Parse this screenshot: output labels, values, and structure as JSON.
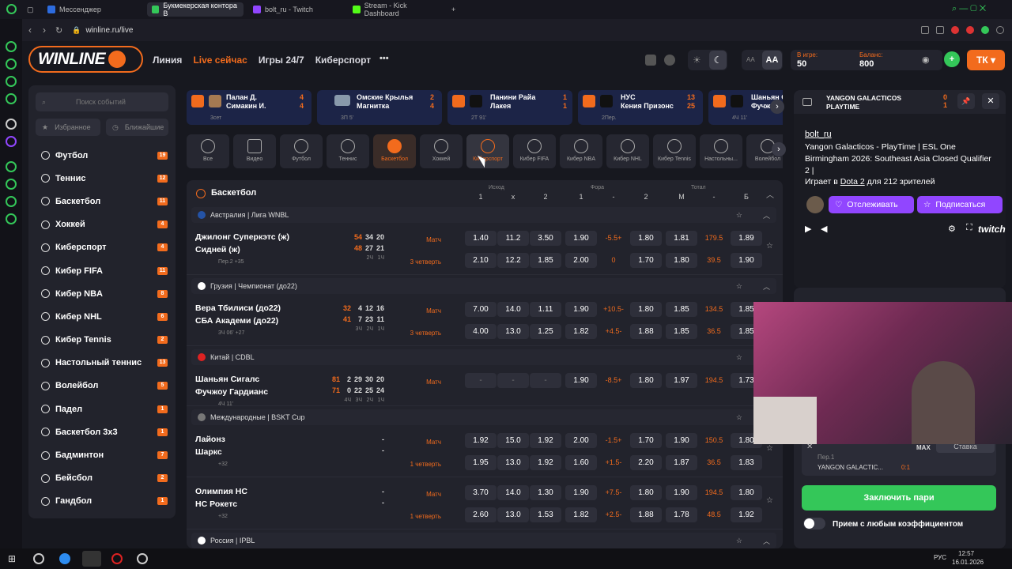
{
  "browser": {
    "tabs": [
      "Мессенджер",
      "Букмекерская контора В",
      "bolt_ru - Twitch",
      "Stream - Kick Dashboard"
    ],
    "url": "winline.ru/live",
    "taskbar_time": "12:57",
    "taskbar_date": "16.01.2026",
    "taskbar_lang": "РУС"
  },
  "header": {
    "logo": "WINLINE",
    "nav": [
      "Линия",
      "Live сейчас",
      "Игры 24/7",
      "Киберспорт"
    ],
    "more": "•••",
    "font_small": "AA",
    "font_large": "AA",
    "in_game_label": "В игре:",
    "in_game_value": "50",
    "balance_label": "Баланс:",
    "balance_value": "800",
    "user_initials": "ТК"
  },
  "sidebar": {
    "search_placeholder": "Поиск событий",
    "tab_fav": "Избранное",
    "tab_near": "Ближайшие",
    "items": [
      {
        "label": "Футбол",
        "count": "19"
      },
      {
        "label": "Теннис",
        "count": "12"
      },
      {
        "label": "Баскетбол",
        "count": "11"
      },
      {
        "label": "Хоккей",
        "count": "4"
      },
      {
        "label": "Киберспорт",
        "count": "4"
      },
      {
        "label": "Кибер FIFA",
        "count": "11"
      },
      {
        "label": "Кибер NBA",
        "count": "8"
      },
      {
        "label": "Кибер NHL",
        "count": "6"
      },
      {
        "label": "Кибер Tennis",
        "count": "2"
      },
      {
        "label": "Настольный теннис",
        "count": "13"
      },
      {
        "label": "Волейбол",
        "count": "5"
      },
      {
        "label": "Падел",
        "count": "1"
      },
      {
        "label": "Баскетбол 3х3",
        "count": "1"
      },
      {
        "label": "Бадминтон",
        "count": "7"
      },
      {
        "label": "Бейсбол",
        "count": "2"
      },
      {
        "label": "Гандбол",
        "count": "1"
      }
    ]
  },
  "live_cards": [
    {
      "t1": "Палан Д.",
      "t2": "Симакин И.",
      "s1": "4",
      "s2": "4",
      "info": "3сет"
    },
    {
      "t1": "Омские Крылья",
      "t2": "Магнитка",
      "s1": "2",
      "s2": "4",
      "info": "3П 5'"
    },
    {
      "t1": "Панини Райа",
      "t2": "Лакея",
      "s1": "1",
      "s2": "1",
      "info": "2Т 91'"
    },
    {
      "t1": "НУС",
      "t2": "Кения Призонс",
      "s1": "13",
      "s2": "25",
      "info": "2Пер."
    },
    {
      "t1": "Шаньян С",
      "t2": "Фучж",
      "s1": "",
      "s2": "",
      "info": "4Ч 11'"
    }
  ],
  "categories": [
    "Все",
    "Видео",
    "Футбол",
    "Теннис",
    "Баскетбол",
    "Хоккей",
    "Киберспорт",
    "Кибер FIFA",
    "Кибер NBA",
    "Кибер NHL",
    "Кибер Tennis",
    "Настольны...",
    "Волейбол"
  ],
  "table": {
    "sport": "Баскетбол",
    "col_groups": [
      "Исход",
      "Фора",
      "Тотал"
    ],
    "cols": [
      "1",
      "x",
      "2",
      "1",
      "-",
      "2",
      "М",
      "-",
      "Б"
    ],
    "leagues": [
      {
        "name": "Австралия | Лига WNBL",
        "matches": [
          {
            "t1": "Джилонг Суперкэтс (ж)",
            "t2": "Сидней (ж)",
            "sc1": [
              "54",
              "34",
              "20"
            ],
            "sc2": [
              "48",
              "27",
              "21"
            ],
            "subsc": [
              "2Ч",
              "1Ч"
            ],
            "info": "Пер.2 +35",
            "label1": "Матч",
            "label2": "3 четверть",
            "r1": [
              "1.40",
              "11.2",
              "3.50",
              "1.90",
              "-5.5+",
              "1.80",
              "1.81",
              "179.5",
              "1.89"
            ],
            "r2": [
              "2.10",
              "12.2",
              "1.85",
              "2.00",
              "0",
              "1.70",
              "1.80",
              "39.5",
              "1.90"
            ]
          }
        ]
      },
      {
        "name": "Грузия | Чемпионат (до22)",
        "matches": [
          {
            "t1": "Вера Тбилиси (до22)",
            "t2": "СБА Академи (до22)",
            "sc1": [
              "32",
              "4",
              "12",
              "16"
            ],
            "sc2": [
              "41",
              "7",
              "23",
              "11"
            ],
            "subsc": [
              "3Ч",
              "2Ч",
              "1Ч"
            ],
            "info": "3Ч 06' +27",
            "label1": "Матч",
            "label2": "3 четверть",
            "r1": [
              "7.00",
              "14.0",
              "1.11",
              "1.90",
              "+10.5-",
              "1.80",
              "1.85",
              "134.5",
              "1.85"
            ],
            "r2": [
              "4.00",
              "13.0",
              "1.25",
              "1.82",
              "+4.5-",
              "1.88",
              "1.85",
              "36.5",
              "1.85"
            ]
          }
        ]
      },
      {
        "name": "Китай | CDBL",
        "matches": [
          {
            "t1": "Шаньян Сигалс",
            "t2": "Фучжоу Гардианс",
            "sc1": [
              "81",
              "2",
              "29",
              "30",
              "20"
            ],
            "sc2": [
              "71",
              "0",
              "22",
              "25",
              "24"
            ],
            "subsc": [
              "4Ч",
              "3Ч",
              "2Ч",
              "1Ч"
            ],
            "info": "4Ч 11'",
            "label1": "Матч",
            "label2": "",
            "r1": [
              "-",
              "-",
              "-",
              "1.90",
              "-8.5+",
              "1.80",
              "1.97",
              "194.5",
              "1.73"
            ],
            "r2": []
          }
        ]
      },
      {
        "name": "Международные | BSKT Cup",
        "matches": [
          {
            "t1": "Лайонз",
            "t2": "Шаркс",
            "sc1": [
              "-"
            ],
            "sc2": [
              "-"
            ],
            "subsc": [],
            "info": "+32",
            "label1": "Матч",
            "label2": "1 четверть",
            "r1": [
              "1.92",
              "15.0",
              "1.92",
              "2.00",
              "-1.5+",
              "1.70",
              "1.90",
              "150.5",
              "1.80"
            ],
            "r2": [
              "1.95",
              "13.0",
              "1.92",
              "1.60",
              "+1.5-",
              "2.20",
              "1.87",
              "36.5",
              "1.83"
            ]
          },
          {
            "t1": "Олимпия НС",
            "t2": "НС Рокетс",
            "sc1": [
              "-"
            ],
            "sc2": [
              "-"
            ],
            "subsc": [],
            "info": "+32",
            "label1": "Матч",
            "label2": "1 четверть",
            "r1": [
              "3.70",
              "14.0",
              "1.30",
              "1.90",
              "+7.5-",
              "1.80",
              "1.90",
              "194.5",
              "1.80"
            ],
            "r2": [
              "2.60",
              "13.0",
              "1.53",
              "1.82",
              "+2.5-",
              "1.88",
              "1.78",
              "48.5",
              "1.92"
            ]
          }
        ]
      },
      {
        "name": "Россия | IPBL",
        "matches": []
      }
    ]
  },
  "stream": {
    "match_title": "YANGON GALACTICOS PLAYTIME",
    "s1": "0",
    "s2": "1",
    "channel": "bolt_ru",
    "title": "Yangon Galacticos - PlayTime | ESL One Birmingham 2026: Southeast Asia Closed Qualifier 2 |",
    "playing_prefix": "Играет в ",
    "game": "Dota 2",
    "viewers_text": " для 212 зрителей",
    "follow": "Отслеживать",
    "subscribe": "Подписаться",
    "brand": "twitch"
  },
  "betslip": {
    "max": "MAX",
    "stake": "Ставка",
    "period": "Пер.1",
    "team": "YANGON GALACTIC...",
    "score": "0:1",
    "place_bet": "Заключить пари",
    "any_odds": "Прием с любым коэффициентом"
  }
}
